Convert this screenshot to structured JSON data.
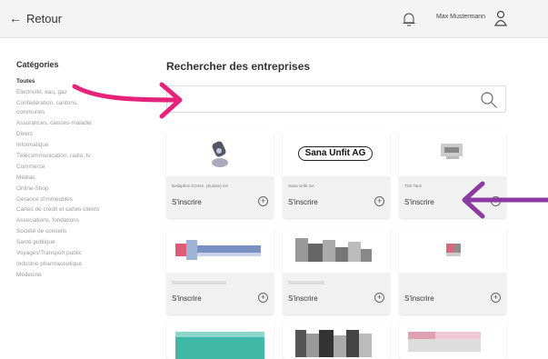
{
  "topbar": {
    "back_label": "Retour",
    "user_name": "Max Mustermann"
  },
  "sidebar": {
    "title": "Catégories",
    "items": [
      "Toutes",
      "Electricité, eau, gaz",
      "Confédération, cantons,",
      "communes",
      "Assurances, caisses-maladie",
      "Divers",
      "Informatique",
      "Télécommunication, radio, tv",
      "Commerce",
      "Médias",
      "Online-Shop",
      "Gérance d'immeubles",
      "Cartes de crédit et cartes clients",
      "Associations, fondations",
      "Société de conseils",
      "Santé publique",
      "Voyages/Transport public",
      "Industrie pharmaceutique",
      "Médecine"
    ]
  },
  "main": {
    "title": "Rechercher des entreprises",
    "search_placeholder": ""
  },
  "cards": [
    {
      "name": "Bellaphon Comm. (Suisse) SA",
      "action": "S'inscrire"
    },
    {
      "name": "Sana Unfit SA",
      "logo_text": "Sana Unfit AG",
      "action": "S'inscrire"
    },
    {
      "name": "Tick Tack",
      "action": "S'inscrire"
    },
    {
      "name": "",
      "action": "S'inscrire"
    },
    {
      "name": "",
      "action": "S'inscrire"
    },
    {
      "name": "",
      "action": "S'inscrire"
    }
  ],
  "colors": {
    "arrow_pink": "#e6237b",
    "arrow_purple": "#8b3aa0"
  }
}
